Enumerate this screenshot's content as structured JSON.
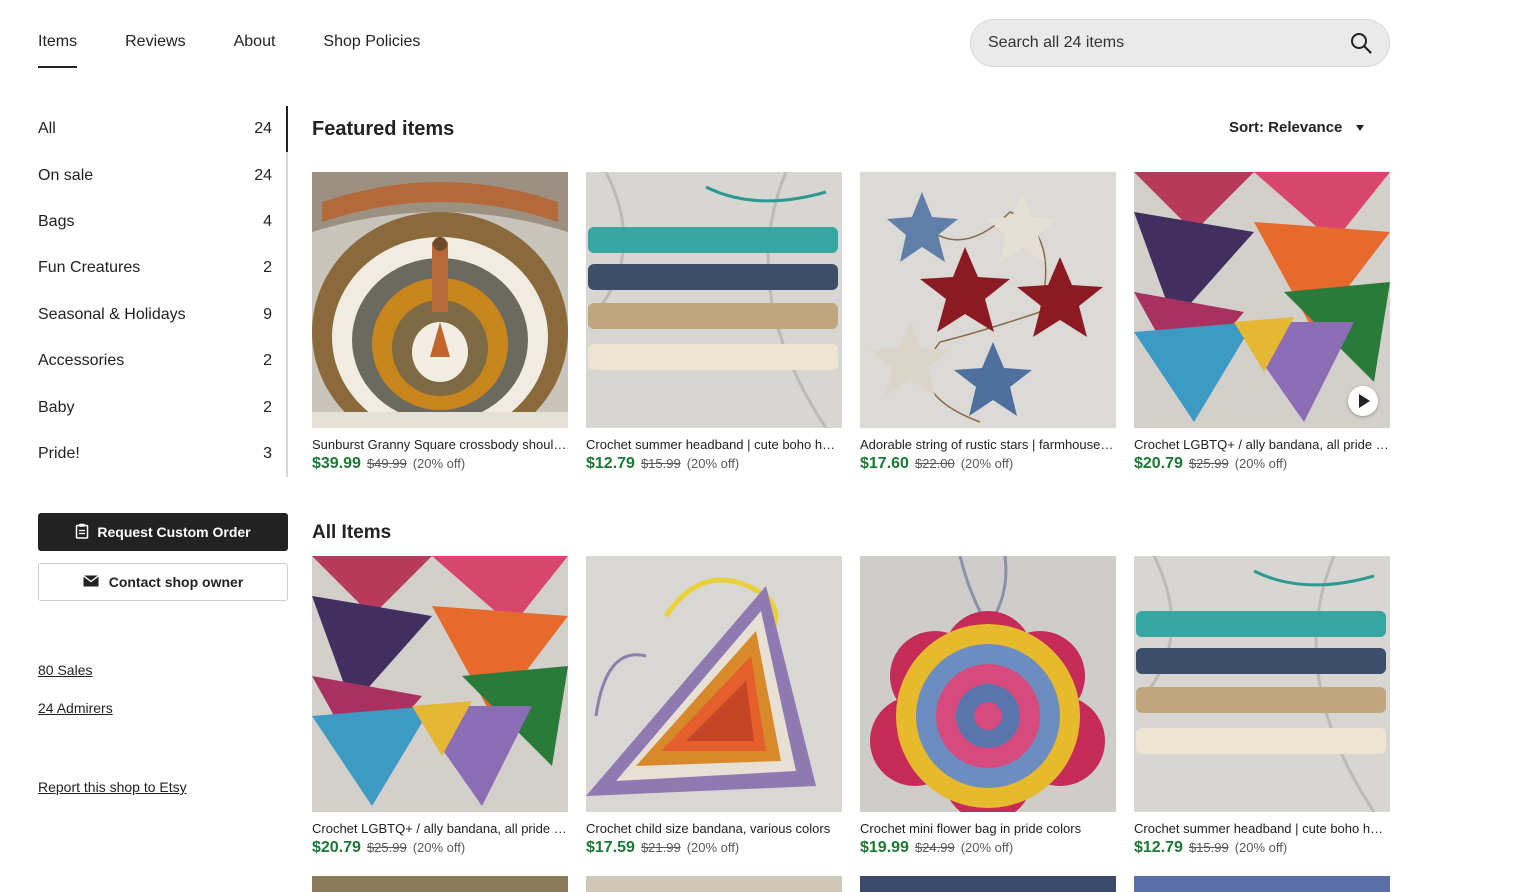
{
  "nav": {
    "tabs": [
      {
        "label": "Items",
        "active": true
      },
      {
        "label": "Reviews"
      },
      {
        "label": "About"
      },
      {
        "label": "Shop Policies"
      }
    ]
  },
  "search": {
    "placeholder": "Search all 24 items",
    "icon": "search-icon"
  },
  "sidebar": {
    "categories": [
      {
        "label": "All",
        "count": "24"
      },
      {
        "label": "On sale",
        "count": "24"
      },
      {
        "label": "Bags",
        "count": "4"
      },
      {
        "label": "Fun Creatures",
        "count": "2"
      },
      {
        "label": "Seasonal & Holidays",
        "count": "9"
      },
      {
        "label": "Accessories",
        "count": "2"
      },
      {
        "label": "Baby",
        "count": "2"
      },
      {
        "label": "Pride!",
        "count": "3"
      }
    ],
    "request_button": "Request Custom Order",
    "contact_button": "Contact shop owner",
    "sales_link": "80 Sales",
    "admirers_link": "24 Admirers",
    "report_link": "Report this shop to Etsy"
  },
  "featured": {
    "title": "Featured items",
    "sort_label": "Sort: Relevance",
    "items": [
      {
        "title": "Sunburst Granny Square crossbody shoulder bag",
        "price": "$39.99",
        "original": "$49.99",
        "discount": "(20% off)"
      },
      {
        "title": "Crochet summer headband | cute boho headband",
        "price": "$12.79",
        "original": "$15.99",
        "discount": "(20% off)"
      },
      {
        "title": "Adorable string of rustic stars | farmhouse garland",
        "price": "$17.60",
        "original": "$22.00",
        "discount": "(20% off)"
      },
      {
        "title": "Crochet LGBTQ+ / ally bandana, all pride colors",
        "price": "$20.79",
        "original": "$25.99",
        "discount": "(20% off)"
      }
    ]
  },
  "all_items": {
    "title": "All Items",
    "items": [
      {
        "title": "Crochet LGBTQ+ / ally bandana, all pride colors",
        "price": "$20.79",
        "original": "$25.99",
        "discount": "(20% off)"
      },
      {
        "title": "Crochet child size bandana, various colors",
        "price": "$17.59",
        "original": "$21.99",
        "discount": "(20% off)"
      },
      {
        "title": "Crochet mini flower bag in pride colors",
        "price": "$19.99",
        "original": "$24.99",
        "discount": "(20% off)"
      },
      {
        "title": "Crochet summer headband | cute boho headband",
        "price": "$12.79",
        "original": "$15.99",
        "discount": "(20% off)"
      }
    ]
  },
  "colors": {
    "price_green": "#1a7a33",
    "button_dark": "#222222",
    "search_bg": "#eaeaea"
  }
}
